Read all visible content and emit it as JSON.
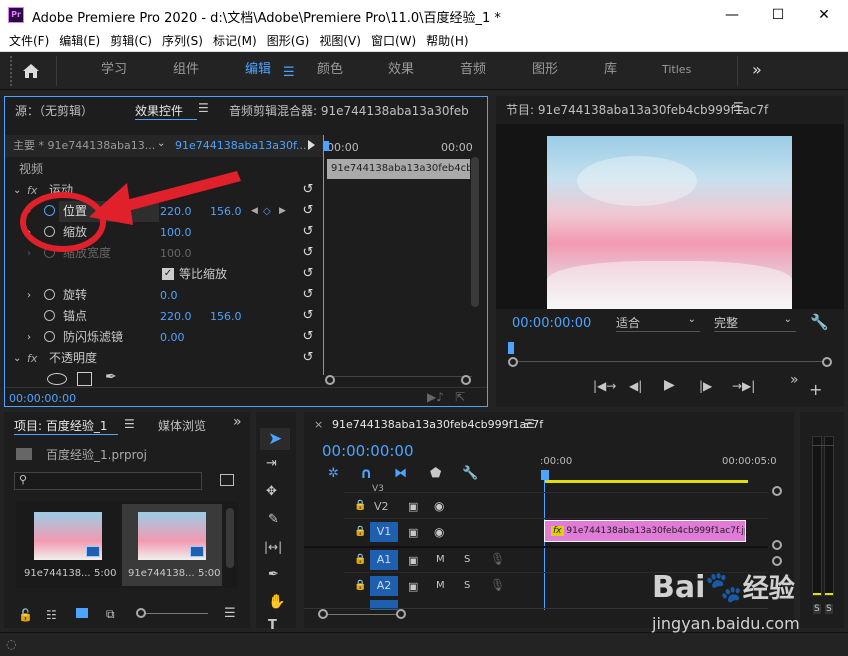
{
  "window": {
    "title": "Adobe Premiere Pro 2020 - d:\\文档\\Adobe\\Premiere Pro\\11.0\\百度经验_1 *",
    "logo": "Pr",
    "minimize": "—",
    "maximize": "☐",
    "close": "✕"
  },
  "menu": [
    "文件(F)",
    "编辑(E)",
    "剪辑(C)",
    "序列(S)",
    "标记(M)",
    "图形(G)",
    "视图(V)",
    "窗口(W)",
    "帮助(H)"
  ],
  "workspaces": {
    "items": [
      "学习",
      "组件",
      "编辑",
      "颜色",
      "效果",
      "音频",
      "图形",
      "库",
      "Titles"
    ],
    "active": "编辑",
    "more": "»"
  },
  "effect_controls": {
    "tabs": {
      "source": "源：（无剪辑）",
      "effects": "效果控件",
      "audio_mixer": "音频剪辑混合器: 91e744138aba13a30feb"
    },
    "master": "主要 * 91e744138aba13...",
    "clip": "91e744138aba13a30f...",
    "time_start": "00:00",
    "time_end": "00:00",
    "clip_bar": "91e744138aba13a30feb4cb9",
    "video_label": "视频",
    "motion": "运动",
    "position": {
      "label": "位置",
      "x": "220.0",
      "y": "156.0"
    },
    "scale": {
      "label": "缩放",
      "value": "100.0"
    },
    "scale_width": {
      "label": "缩放宽度",
      "value": "100.0"
    },
    "uniform": "等比缩放",
    "rotation": {
      "label": "旋转",
      "value": "0.0"
    },
    "anchor": {
      "label": "锚点",
      "x": "220.0",
      "y": "156.0"
    },
    "antiflicker": {
      "label": "防闪烁滤镜",
      "value": "0.00"
    },
    "opacity": "不透明度",
    "timecode": "00:00:00:00",
    "fx": "fx"
  },
  "program": {
    "title": "节目: 91e744138aba13a30feb4cb999f1ac7f",
    "timecode": "00:00:00:00",
    "fit": "适合",
    "quality": "完整"
  },
  "project": {
    "tabs": {
      "project": "项目: 百度经验_1",
      "media": "媒体浏览"
    },
    "file": "百度经验_1.prproj",
    "items": [
      {
        "name": "91e744138...",
        "dur": "5:00"
      },
      {
        "name": "91e744138...",
        "dur": "5:00"
      }
    ]
  },
  "timeline": {
    "title": "91e744138aba13a30feb4cb999f1ac7f",
    "timecode": "00:00:00:00",
    "ruler_start": ":00:00",
    "ruler_end": "00:00:05:0",
    "tracks": [
      {
        "name": "V3"
      },
      {
        "name": "V2"
      },
      {
        "name": "V1"
      },
      {
        "name": "A1"
      },
      {
        "name": "A2"
      },
      {
        "name": "A3"
      }
    ],
    "clip": "91e744138aba13a30feb4cb999f1ac7f.jpe",
    "m": "M",
    "s": "S"
  },
  "meter": {
    "s1": "S",
    "s2": "S"
  },
  "watermark": {
    "brand": "Bai",
    "brand2": "经验",
    "url": "jingyan.baidu.com"
  },
  "colors": {
    "accent": "#4da3ff",
    "clip": "#e07bd8",
    "workarea": "#e0e000",
    "annotation": "#e0202a"
  }
}
